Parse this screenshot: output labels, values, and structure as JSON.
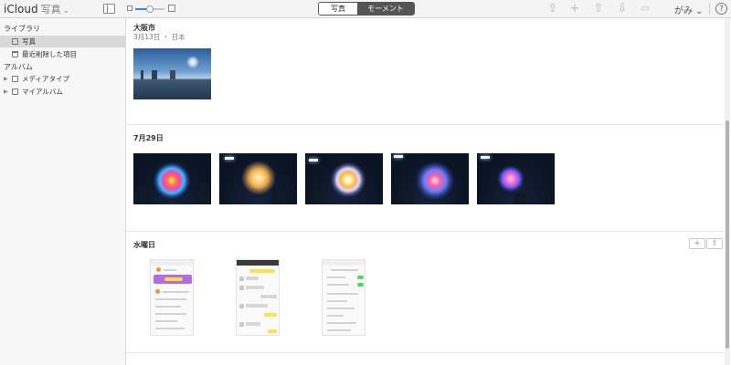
{
  "topbar": {
    "brand": "iCloud",
    "app_name": "写真",
    "app_caret": "⌄",
    "segments": [
      "写真",
      "モーメント"
    ],
    "selected_segment": "モーメント",
    "zoom_level": 0.5,
    "tools": {
      "upload_glyph": "⇪",
      "add_glyph": "+",
      "share_glyph": "⇧",
      "download_glyph": "⇩",
      "trash_glyph": "🗑"
    },
    "user_name": "がみ ⌄",
    "help_glyph": "?"
  },
  "sidebar": {
    "library_heading": "ライブラリ",
    "library_items": [
      {
        "label": "写真",
        "icon": "photos-icon",
        "selected": true
      },
      {
        "label": "最近削除した項目",
        "icon": "trash-icon",
        "selected": false
      }
    ],
    "albums_heading": "アルバム",
    "album_items": [
      {
        "label": "メディアタイプ",
        "icon": "album-icon"
      },
      {
        "label": "マイアルバム",
        "icon": "album-icon"
      }
    ]
  },
  "moments": [
    {
      "title": "大阪市",
      "subtitle": "3月13日 ・ 日本",
      "photo_count": 1
    },
    {
      "title": "7月29日",
      "subtitle": "",
      "photo_count": 5
    },
    {
      "title": "水曜日",
      "subtitle": "",
      "photo_count": 3,
      "actions": [
        "+",
        "⇧"
      ]
    }
  ],
  "colors": {
    "selected_segment_bg": "#555555",
    "sidebar_bg": "#f7f7f7",
    "sidebar_selected": "#d9d9d9",
    "slider_accent": "#3a82f7"
  }
}
